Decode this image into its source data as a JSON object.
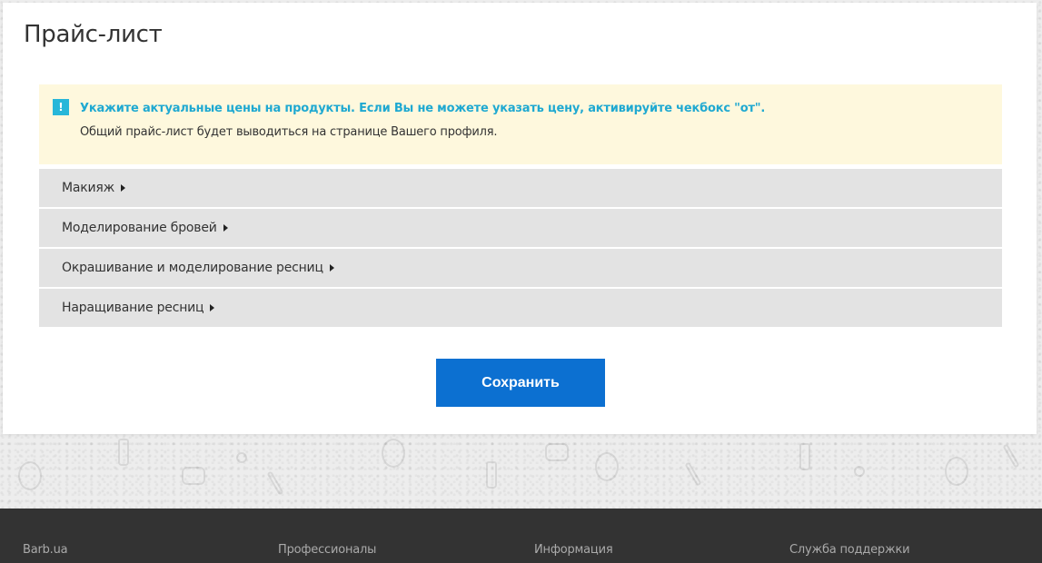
{
  "page": {
    "title": "Прайс-лист"
  },
  "notice": {
    "icon": "!",
    "main_text": "Укажите актуальные цены на продукты. Если Вы не можете указать цену, активируйте чекбокс \"от\".",
    "sub_text": "Общий прайс-лист будет выводиться на странице Вашего профиля."
  },
  "categories": [
    {
      "label": "Макияж"
    },
    {
      "label": "Моделирование бровей"
    },
    {
      "label": "Окрашивание и моделирование ресниц"
    },
    {
      "label": "Наращивание ресниц"
    }
  ],
  "actions": {
    "save_label": "Сохранить"
  },
  "footer": {
    "columns": [
      "Barb.ua",
      "Профессионалы",
      "Информация",
      "Служба поддержки"
    ]
  },
  "colors": {
    "accent": "#0c70d1",
    "notice_text": "#1fa9d1",
    "notice_bg": "#fef8dd",
    "category_bg": "#e3e3e3",
    "footer_bg": "#333333"
  },
  "icons": {
    "notice": "info-exclamation-icon",
    "category_toggle": "caret-right-icon"
  }
}
